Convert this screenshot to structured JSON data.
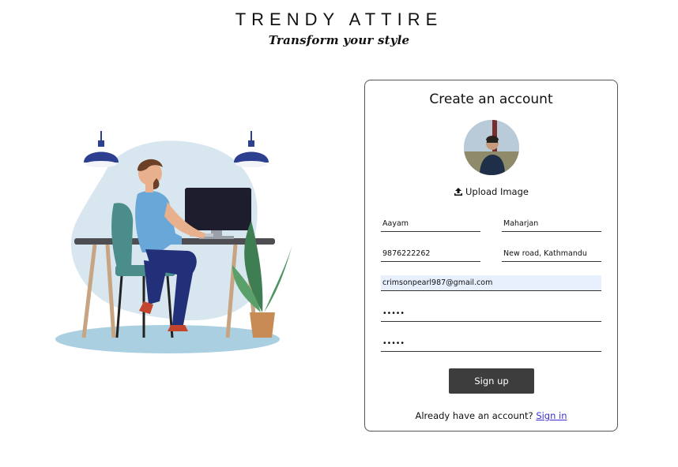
{
  "brand": {
    "title": "TRENDY ATTIRE",
    "tagline": "Transform your style"
  },
  "form": {
    "title": "Create an account",
    "upload_label": "Upload Image",
    "fields": {
      "first_name": "Aayam",
      "last_name": "Maharjan",
      "phone": "9876222262",
      "address": "New road, Kathmandu",
      "email": "crimsonpearl987@gmail.com",
      "password": "•••••",
      "confirm_password": "•••••"
    },
    "signup_label": "Sign up",
    "signin_prompt": "Already have an account?",
    "signin_link": "Sign in"
  },
  "colors": {
    "button_bg": "#3d3d3d",
    "link": "#3a2fd6",
    "autofill_bg": "#e8f0fe",
    "illustration_blob": "#d8e6ef",
    "lamp": "#2d3f8f"
  },
  "icons": {
    "upload": "upload-icon"
  }
}
